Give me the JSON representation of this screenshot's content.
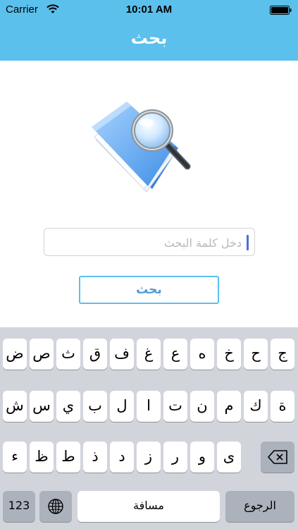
{
  "status_bar": {
    "carrier": "Carrier",
    "time": "10:01 AM"
  },
  "nav": {
    "title": "بحث"
  },
  "search": {
    "placeholder": "دخل كلمة البحث",
    "button_label": "بحث"
  },
  "keyboard": {
    "row1": [
      "ج",
      "ح",
      "خ",
      "ه",
      "ع",
      "غ",
      "ف",
      "ق",
      "ث",
      "ص",
      "ض"
    ],
    "row2": [
      "ة",
      "ك",
      "م",
      "ن",
      "ت",
      "ا",
      "ل",
      "ب",
      "ي",
      "س",
      "ش"
    ],
    "row3": [
      "ى",
      "و",
      "ر",
      "ز",
      "د",
      "ذ",
      "ط",
      "ظ",
      "ء"
    ],
    "numbers_label": "123",
    "space_label": "مسافة",
    "return_label": "الرجوع"
  },
  "colors": {
    "accent": "#5bc0eb",
    "button_text": "#4f9ad1",
    "keyboard_bg": "#d1d5db"
  },
  "icons": [
    "wifi-icon",
    "battery-icon",
    "folder-search-icon",
    "globe-icon",
    "backspace-icon"
  ]
}
